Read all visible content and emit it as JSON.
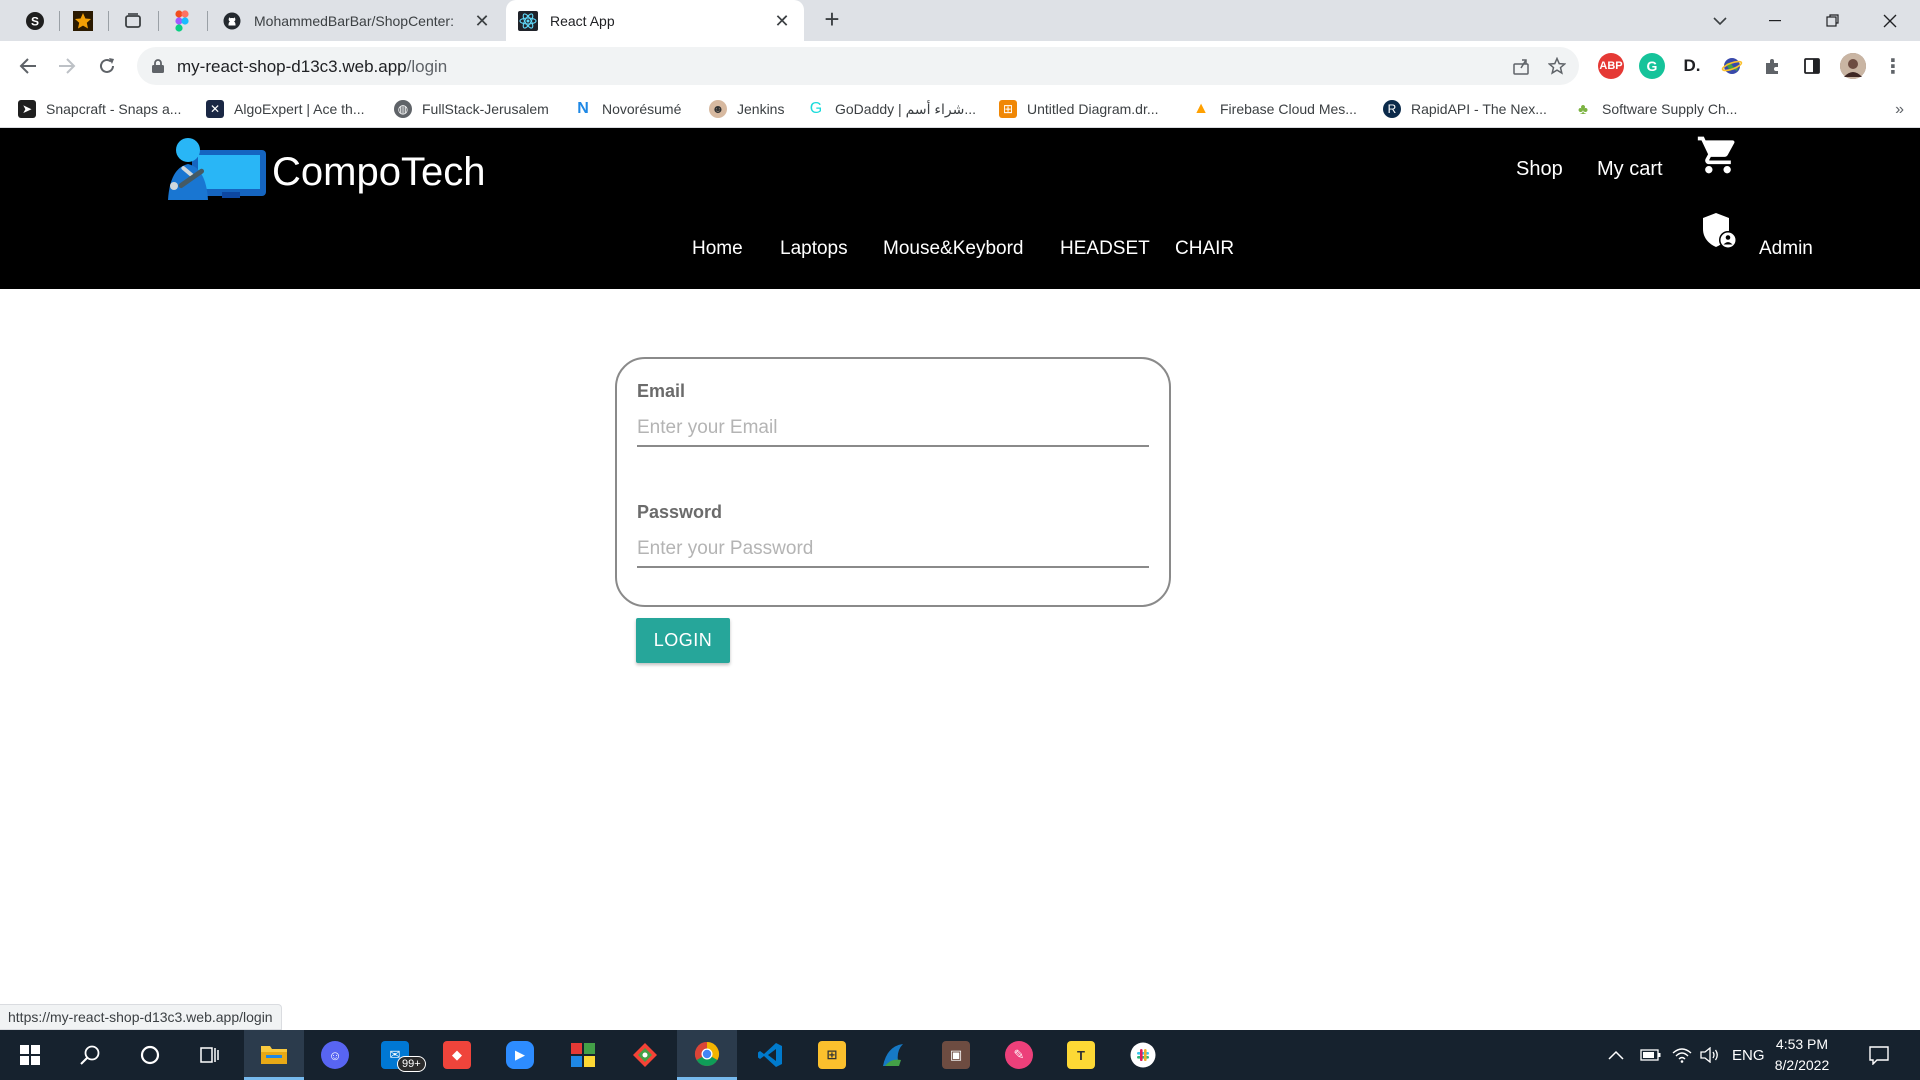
{
  "browser": {
    "tabs": [
      {
        "title": "MohammedBarBar/ShopCenter: ",
        "icon": "github-icon"
      },
      {
        "title": "React App",
        "icon": "react-icon"
      }
    ],
    "address": {
      "host": "my-react-shop-d13c3.web.app",
      "path": "/login"
    },
    "bookmarks": [
      {
        "label": "Snapcraft - Snaps a...",
        "icon": "snapcraft-icon"
      },
      {
        "label": "AlgoExpert | Ace th...",
        "icon": "algoexpert-icon"
      },
      {
        "label": "FullStack-Jerusalem",
        "icon": "globe-icon"
      },
      {
        "label": "Novorésumé",
        "icon": "novoresume-icon"
      },
      {
        "label": "Jenkins",
        "icon": "jenkins-icon"
      },
      {
        "label": "GoDaddy | شراء أسم...",
        "icon": "godaddy-icon"
      },
      {
        "label": "Untitled Diagram.dr...",
        "icon": "drawio-icon"
      },
      {
        "label": "Firebase Cloud Mes...",
        "icon": "firebase-icon"
      },
      {
        "label": "RapidAPI - The Nex...",
        "icon": "rapidapi-icon"
      },
      {
        "label": "Software Supply Ch...",
        "icon": "supplychain-icon"
      }
    ],
    "extensions": {
      "adblock": "ABP",
      "grammarly": "G",
      "dashlane": "D."
    },
    "status_url": "https://my-react-shop-d13c3.web.app/login"
  },
  "site": {
    "brand": "CompoTech",
    "shop_label": "Shop",
    "cart_label": "My cart",
    "nav": [
      "Home",
      "Laptops",
      "Mouse&Keybord",
      "HEADSET",
      "CHAIR"
    ],
    "admin_label": "Admin"
  },
  "login": {
    "email_label": "Email",
    "email_placeholder": "Enter your Email",
    "password_label": "Password",
    "password_placeholder": "Enter your Password",
    "button_label": "LOGIN",
    "accent_color": "#26a69a"
  },
  "taskbar": {
    "mail_badge": "99+",
    "language": "ENG",
    "time": "4:53 PM",
    "date": "8/2/2022"
  }
}
